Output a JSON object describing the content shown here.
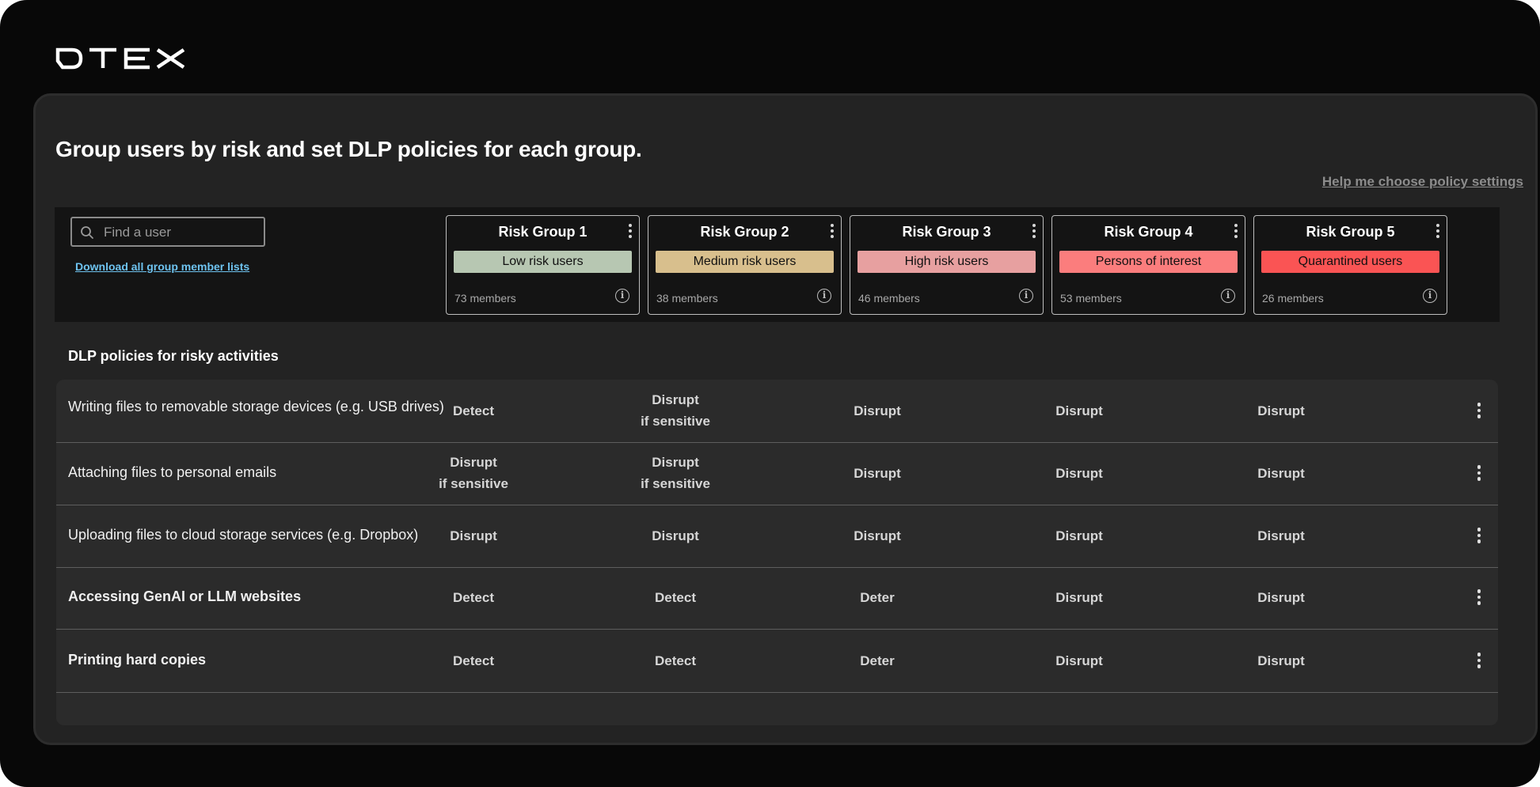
{
  "brand": {
    "logo_text": "DTEX"
  },
  "page": {
    "title": "Group users by risk and set DLP policies for each group.",
    "help_link": "Help me choose policy settings"
  },
  "search": {
    "placeholder": "Find a user",
    "value": ""
  },
  "download_link": "Download all group member lists",
  "risk_groups": [
    {
      "name": "Risk Group 1",
      "badge": "Low risk users",
      "members": "73 members",
      "color": "#b7c7b2"
    },
    {
      "name": "Risk Group 2",
      "badge": "Medium risk users",
      "members": "38 members",
      "color": "#d8bf8d"
    },
    {
      "name": "Risk Group 3",
      "badge": "High risk users",
      "members": "46 members",
      "color": "#e7a0a0"
    },
    {
      "name": "Risk Group 4",
      "badge": "Persons of interest",
      "members": "53 members",
      "color": "#fb7d7d"
    },
    {
      "name": "Risk Group 5",
      "badge": "Quarantined users",
      "members": "26 members",
      "color": "#fa5454"
    }
  ],
  "policies": {
    "section_title": "DLP policies for risky activities",
    "rows": [
      {
        "activity": "Writing files to removable storage devices (e.g. USB drives)",
        "bold": false,
        "settings": [
          [
            "Detect"
          ],
          [
            "Disrupt",
            "if sensitive"
          ],
          [
            "Disrupt"
          ],
          [
            "Disrupt"
          ],
          [
            "Disrupt"
          ]
        ]
      },
      {
        "activity": "Attaching files to personal emails",
        "bold": false,
        "settings": [
          [
            "Disrupt",
            "if sensitive"
          ],
          [
            "Disrupt",
            "if sensitive"
          ],
          [
            "Disrupt"
          ],
          [
            "Disrupt"
          ],
          [
            "Disrupt"
          ]
        ]
      },
      {
        "activity": "Uploading files to cloud storage services (e.g. Dropbox)",
        "bold": false,
        "settings": [
          [
            "Disrupt"
          ],
          [
            "Disrupt"
          ],
          [
            "Disrupt"
          ],
          [
            "Disrupt"
          ],
          [
            "Disrupt"
          ]
        ]
      },
      {
        "activity": "Accessing GenAI or LLM websites",
        "bold": true,
        "settings": [
          [
            "Detect"
          ],
          [
            "Detect"
          ],
          [
            "Deter"
          ],
          [
            "Disrupt"
          ],
          [
            "Disrupt"
          ]
        ]
      },
      {
        "activity": "Printing hard copies",
        "bold": true,
        "settings": [
          [
            "Detect"
          ],
          [
            "Detect"
          ],
          [
            "Deter"
          ],
          [
            "Disrupt"
          ],
          [
            "Disrupt"
          ]
        ]
      }
    ]
  }
}
